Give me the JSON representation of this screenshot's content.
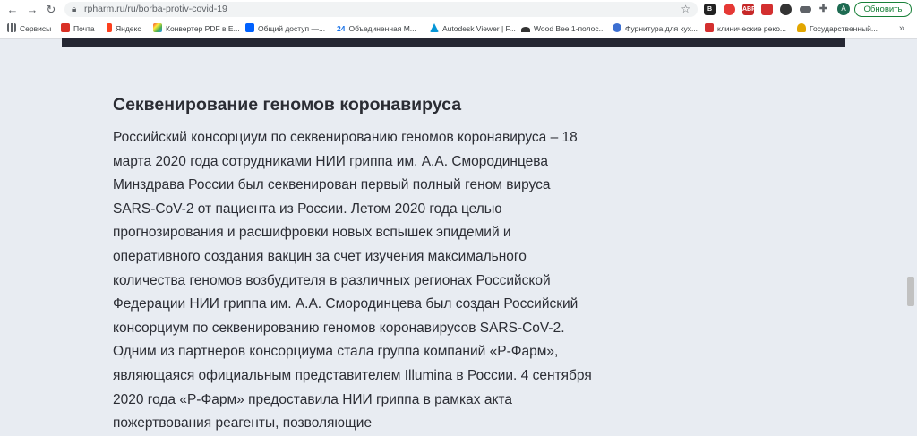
{
  "browser": {
    "url": "rpharm.ru/ru/borba-protiv-covid-19",
    "update_label": "Обновить",
    "avatar_letter": "А",
    "extension_labels": [
      "В",
      "",
      "ABP",
      "",
      "",
      "",
      ""
    ]
  },
  "bookmarks": [
    {
      "label": "Сервисы",
      "color": "#5f6368"
    },
    {
      "label": "Почта",
      "color": "#d93025"
    },
    {
      "label": "Яндекс",
      "color": "#fc3f1d"
    },
    {
      "label": "Конвертер PDF в E...",
      "color": "#7b5ce0"
    },
    {
      "label": "Общий доступ —...",
      "color": "#0061fe"
    },
    {
      "label": "Объединенная М...",
      "color": "#1a73e8"
    },
    {
      "label": "Autodesk Viewer | F...",
      "color": "#0696d7"
    },
    {
      "label": "Wood Bee 1-полос...",
      "color": "#333333"
    },
    {
      "label": "Фурнитура для кух...",
      "color": "#3c6fd1"
    },
    {
      "label": "клинические реко...",
      "color": "#d32f2f"
    },
    {
      "label": "Государственный...",
      "color": "#e2a600"
    }
  ],
  "article": {
    "heading": "Секвенирование геномов коронавируса",
    "paragraph": "Российский консорциум по секвенированию геномов коронавируса – 18 марта 2020 года сотрудниками НИИ гриппа им. А.А. Смородинцева Минздрава России был секвенирован первый полный геном вируса SARS-CoV-2 от пациента из России. Летом 2020 года целью прогнозирования и расшифровки новых вспышек эпидемий и оперативного создания вакцин за счет изучения максимального количества геномов возбудителя в различных регионах Российской Федерации НИИ гриппа им. А.А. Смородинцева был создан Российский консорциум по секвенированию геномов коронавирусов SARS-CoV-2. Одним из партнеров консорциума стала группа компаний «Р-Фарм», являющаяся официальным представителем Illumina в России. 4 сентября 2020 года «Р-Фарм» предоставила НИИ гриппа в рамках акта пожертвования реагенты, позволяющие"
  },
  "colors": {
    "page_bg": "#e8ecf2",
    "dark_bar": "#252733",
    "text": "#2b2d34",
    "update_green": "#188038"
  }
}
